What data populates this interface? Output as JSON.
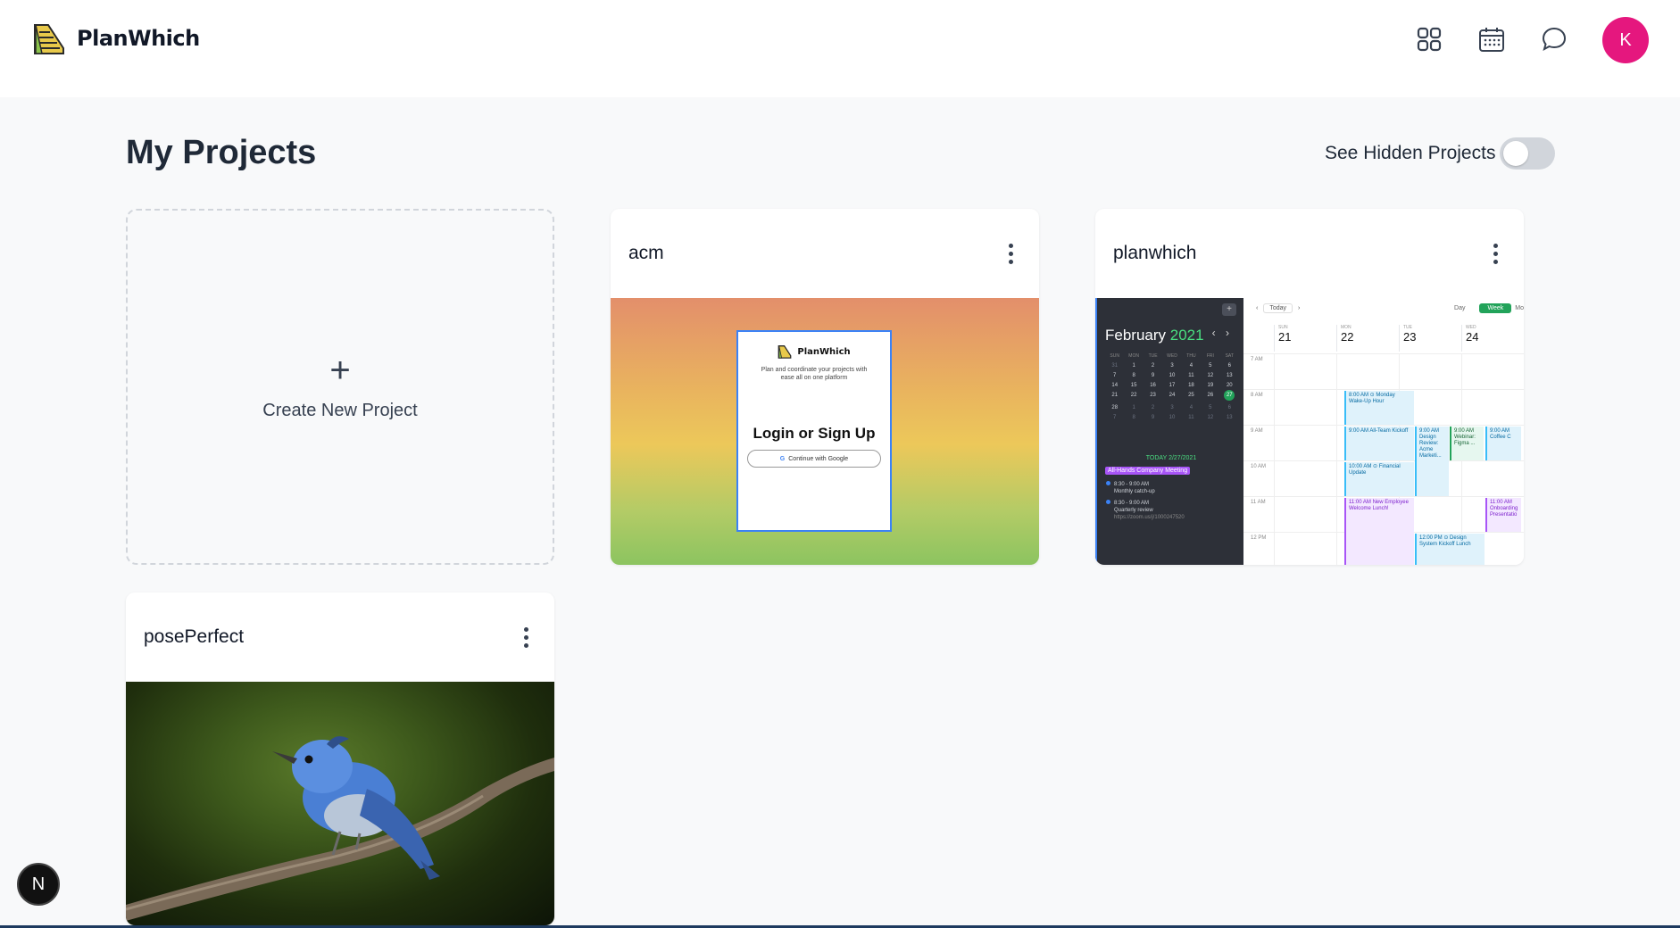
{
  "app": {
    "brand": "PlanWhich",
    "avatar_initial": "K",
    "avatar_color": "#e5177e"
  },
  "header": {
    "icons": [
      "grid-icon",
      "calendar-icon",
      "chat-bubble-icon"
    ]
  },
  "page": {
    "title": "My Projects",
    "hidden_toggle_label": "See Hidden Projects",
    "hidden_toggle_on": false
  },
  "create": {
    "label": "Create New Project",
    "plus": "+"
  },
  "projects": [
    {
      "name": "acm",
      "preview": {
        "brand": "PlanWhich",
        "tagline": "Plan and coordinate your projects with ease all on one platform",
        "heading": "Login or Sign Up",
        "google_btn": "Continue with Google",
        "google_g": "G"
      }
    },
    {
      "name": "planwhich",
      "preview": {
        "month": "February",
        "year": "2021",
        "nav": "‹ ›",
        "add": "+",
        "weekdays": [
          "SUN",
          "MON",
          "TUE",
          "WED",
          "THU",
          "FRI",
          "SAT"
        ],
        "today_label": "TODAY  2/27/2021",
        "pill": "All-Hands Company Meeting",
        "ev1_time": "8:30 - 9:00 AM",
        "ev1_name": "Monthly catch-up",
        "ev2_time": "8:30 - 9:00 AM",
        "ev2_name": "Quarterly review",
        "ev2_link": "https://zoom.us/j/1000247520",
        "top_prev": "‹",
        "top_today": "Today",
        "top_next": "›",
        "view_day": "Day",
        "view_week": "Week",
        "view_month": "Mo",
        "days": [
          {
            "name": "SUN",
            "date": "21"
          },
          {
            "name": "MON",
            "date": "22"
          },
          {
            "name": "TUE",
            "date": "23"
          },
          {
            "name": "WED",
            "date": "24"
          }
        ],
        "hours": [
          "7 AM",
          "8 AM",
          "9 AM",
          "10 AM",
          "11 AM",
          "12 PM"
        ],
        "events": {
          "monday_wakeup": "8:00 AM ⊙ Monday Wake-Up Hour",
          "allteam": "9:00 AM All-Team Kickoff",
          "financial": "10:00 AM ⊙ Financial Update",
          "new_employee": "11:00 AM New Employee Welcome Lunch!",
          "design_review": "9:00 AM Design Review: Acme Marketi...",
          "webinar": "9:00 AM Webinar: Figma ...",
          "coffee": "9:00 AM Coffee C",
          "onboarding": "11:00 AM Onboarding Presentatio",
          "design_system": "12:00 PM ⊙ Design System Kickoff Lunch"
        }
      }
    },
    {
      "name": "posePerfect",
      "preview": {}
    }
  ],
  "dev_badge": "N"
}
